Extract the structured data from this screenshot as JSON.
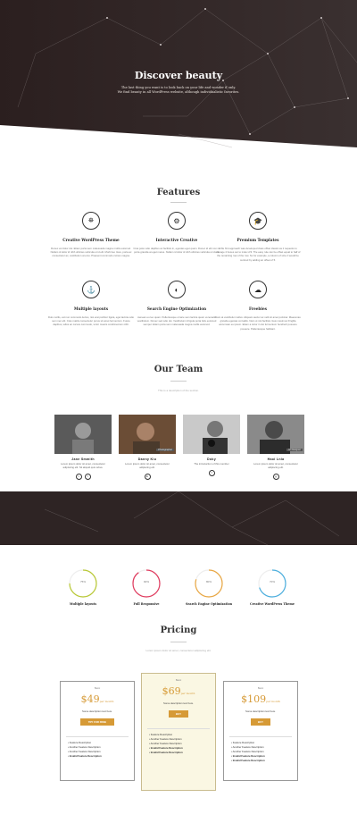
{
  "hero": {
    "title": "Discover beauty",
    "subtitle_line1": "The last thing you want is to look back on your life and wonder if only.",
    "subtitle_line2": "We find beauty in all WordPress website, although individualistic favorites."
  },
  "features": {
    "title": "Features",
    "items": [
      {
        "icon": "binoculars-icon",
        "glyph": "⛯",
        "title": "Creative WordPress Theme",
        "desc": "Donec vel dolor dui. Etiam porta sem malesuada magna mollis euismod. Nullam id dolor id nibh ultricies vehicula ut id elit. Morbi leo risus, porta ac consectetur ac, vestibulum at eros. Praesent commodo cursus magna."
      },
      {
        "icon": "gear-icon",
        "glyph": "⚙",
        "title": "Interactive Creative",
        "desc": "Cras justo odio dapibus ac facilisis in, egestas eget quam. Donec id elit non mi porta gravida at eget metus. Nullam id dolor id nibh ultricies vehicula ut id elit."
      },
      {
        "icon": "graduation-cap-icon",
        "glyph": "🎓",
        "title": "Premium Templates",
        "desc": "A file first approach was developed class offset classic as it requests to manage 4 boxes out to index 2/3. The easy rule can be offset equal to half of the remaining row of the row. So for example, a column of size 2 would be centred by adding an offset of 5."
      },
      {
        "icon": "anchor-icon",
        "glyph": "⚓",
        "title": "Multiple layouts",
        "desc": "Duis mollis, est non commodo luctus, nisi erat porttitor ligula, eget lacinia odio sem nec elit. Cras mattis consectetur purus sit amet fermentum. Fusce dapibus, tellus ac cursus commodo, tortor mauris condimentum nibh."
      },
      {
        "icon": "contrast-icon",
        "glyph": "◐",
        "title": "Search Engine Optimization",
        "desc": "Aenean eu leo quam. Pellentesque ornare sem lacinia quam venenatis vestibulum. Donec sed odio dui. Vestibulum id ligula porta felis euismod semper. Etiam porta sem malesuada magna mollis euismod."
      },
      {
        "icon": "cloud-upload-icon",
        "glyph": "☁",
        "title": "Freebies",
        "desc": "Nam at vestibulum tellus. Aliquam auctor ac velit sit amet pulvinar. Maecenas gravida egestas convallis. Nam ut nisi facilisis risus maximus fringilla accumsan eu ipsum. Etiam a tortor in dui fermentum hendrerit posuere posuere. Pellentesque habitant."
      }
    ]
  },
  "team": {
    "title": "Our Team",
    "subtitle": "This is a description of the section.",
    "members": [
      {
        "name": "Jane Smmith",
        "role": "Lorem ipsum dolor sit amet, consectetur adipiscing elit. Sit aliquid quis rebus.",
        "tag": "",
        "social": [
          "t",
          "f"
        ]
      },
      {
        "name": "Danny Kiu",
        "role": "Lorem ipsum dolor sit amet, consectetur adipiscing elit.",
        "tag": "Photographer",
        "social": [
          "in"
        ]
      },
      {
        "name": "Doky",
        "role": "The introduction of this member",
        "tag": "",
        "social": [
          "f"
        ]
      },
      {
        "name": "Haoi Lnla",
        "role": "Lorem ipsum dolor sit amet, consectetur adipiscing elit.",
        "tag": "UI Designer",
        "social": [
          "g"
        ]
      }
    ]
  },
  "stats": {
    "items": [
      {
        "label": "Multiple layouts",
        "value": "75%",
        "fraction": 0.75,
        "color": "#b8c832"
      },
      {
        "label": "Full Responsive",
        "value": "90%",
        "fraction": 0.9,
        "color": "#e0395d"
      },
      {
        "label": "Search Engine Optimization",
        "value": "80%",
        "fraction": 0.8,
        "color": "#e9a640"
      },
      {
        "label": "Creative WordPress Theme",
        "value": "70%",
        "fraction": 0.7,
        "color": "#4aaede"
      }
    ]
  },
  "pricing": {
    "title": "Pricing",
    "subtitle": "Lorem ipsum dolor sit amet, consectetur adipiscing elit.",
    "plans": [
      {
        "name": "Basic",
        "price": "$49",
        "per": "per month",
        "desc": "Some description text here.",
        "button": "TRY FOR FREE",
        "features": [
          "Feature Description",
          "Another Feature Description",
          "Another Feature Description",
          "Invalid Feature Description"
        ]
      },
      {
        "name": "Basic",
        "price": "$69",
        "per": "per month",
        "desc": "Some description text here.",
        "button": "BUY",
        "features": [
          "Feature Description",
          "Another Feature Description",
          "Another Feature Description",
          "Invalid Feature Description",
          "Invalid Feature Description"
        ]
      },
      {
        "name": "Basic",
        "price": "$109",
        "per": "per month",
        "desc": "Some description text here.",
        "button": "BUY",
        "features": [
          "Feature Description",
          "Another Feature Description",
          "Another Feature Description",
          "Invalid Feature Description",
          "Invalid Feature Description"
        ]
      }
    ]
  },
  "colors": {
    "accent": "#d69a36",
    "hero_dark": "#2a2020"
  }
}
